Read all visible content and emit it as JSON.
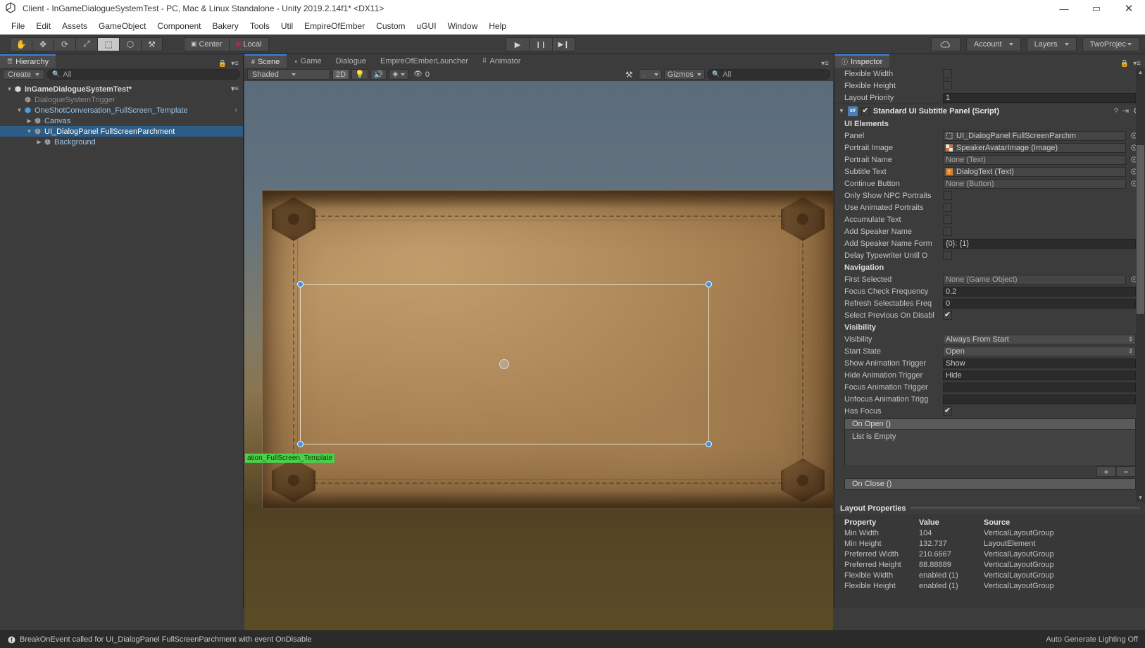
{
  "window": {
    "title": "Client - InGameDialogueSystemTest - PC, Mac & Linux Standalone - Unity 2019.2.14f1* <DX11>",
    "app_icon": "unity-icon",
    "minimize": "—",
    "maximize": "▭",
    "close": "✕"
  },
  "menubar": {
    "items": [
      {
        "label": "File"
      },
      {
        "label": "Edit"
      },
      {
        "label": "Assets"
      },
      {
        "label": "GameObject"
      },
      {
        "label": "Component"
      },
      {
        "label": "Bakery"
      },
      {
        "label": "Tools"
      },
      {
        "label": "Util"
      },
      {
        "label": "EmpireOfEmber"
      },
      {
        "label": "Custom"
      },
      {
        "label": "uGUI"
      },
      {
        "label": "Window"
      },
      {
        "label": "Help"
      }
    ]
  },
  "toolbar": {
    "transform_tools": [
      {
        "name": "hand-tool",
        "glyph": "✋",
        "active": false
      },
      {
        "name": "move-tool",
        "glyph": "✥",
        "active": false
      },
      {
        "name": "rotate-tool",
        "glyph": "⟳",
        "active": false
      },
      {
        "name": "scale-tool",
        "glyph": "⤢",
        "active": false
      },
      {
        "name": "rect-tool",
        "glyph": "⬚",
        "active": true
      },
      {
        "name": "transform-tool",
        "glyph": "⬡",
        "active": false
      },
      {
        "name": "custom-tool",
        "glyph": "⚒",
        "active": false
      }
    ],
    "pivot_mode": "Center",
    "pivot_rotation": "Local",
    "play": "▶",
    "pause": "❙❙",
    "step": "▶❙",
    "cloud_label": "cloud-icon",
    "account": "Account",
    "layers": "Layers",
    "layout": "TwoProjec"
  },
  "hierarchy": {
    "tab": "Hierarchy",
    "create_label": "Create",
    "search_placeholder": "All",
    "items": [
      {
        "label": "InGameDialogueSystemTest*",
        "indent": 0,
        "arrow": "▼",
        "style": "root",
        "selected": false,
        "icon": "scene-icon"
      },
      {
        "label": "DialogueSystemTrigger",
        "indent": 1,
        "arrow": "",
        "style": "dim",
        "selected": false,
        "icon": "cube-icon"
      },
      {
        "label": "OneShotConversation_FullScreen_Template",
        "indent": 1,
        "arrow": "▼",
        "style": "blue",
        "selected": false,
        "icon": "prefab-icon"
      },
      {
        "label": "Canvas",
        "indent": 2,
        "arrow": "▶",
        "style": "blue",
        "selected": false,
        "icon": "cube-icon"
      },
      {
        "label": "UI_DialogPanel FullScreenParchment",
        "indent": 2,
        "arrow": "▼",
        "style": "sel",
        "selected": true,
        "icon": "cube-icon"
      },
      {
        "label": "Background",
        "indent": 3,
        "arrow": "▶",
        "style": "blue",
        "selected": false,
        "icon": "cube-icon"
      }
    ]
  },
  "scene": {
    "tabs": [
      {
        "label": "Scene",
        "icon": "scene-grid-icon",
        "active": true
      },
      {
        "label": "Game",
        "icon": "game-icon",
        "active": false
      },
      {
        "label": "Dialogue",
        "icon": "",
        "active": false
      },
      {
        "label": "EmpireOfEmberLauncher",
        "icon": "",
        "active": false
      },
      {
        "label": "Animator",
        "icon": "animator-icon",
        "active": false
      }
    ],
    "draw_mode": "Shaded",
    "mode_2d": "2D",
    "lighting_icon": "light-bulb-icon",
    "audio_icon": "speaker-icon",
    "fx_icon": "effects-icon",
    "hidden_count": "0",
    "tools_icon": "tools-icon",
    "camera_icon": "camera-icon",
    "gizmos_label": "Gizmos",
    "gizmo_search_placeholder": "All",
    "gizmo_object_label": "ation_FullScreen_Template"
  },
  "inspector": {
    "tab": "Inspector",
    "top_rows": [
      {
        "label": "Flexible Width",
        "type": "checkbox",
        "checked": false
      },
      {
        "label": "Flexible Height",
        "type": "checkbox",
        "checked": false
      },
      {
        "label": "Layout Priority",
        "type": "text",
        "value": "1"
      }
    ],
    "component": {
      "title": "Standard UI Subtitle Panel (Script)",
      "enabled": true,
      "foldout": "▼",
      "help_icon": "help-icon",
      "preset_icon": "preset-icon",
      "gear_icon": "gear-icon"
    },
    "sections": [
      {
        "heading": "UI Elements",
        "rows": [
          {
            "label": "Panel",
            "type": "object",
            "value": "UI_DialogPanel FullScreenParchm",
            "icon": "rect-transform-icon",
            "picker": true
          },
          {
            "label": "Portrait Image",
            "type": "object",
            "value": "SpeakerAvatarImage (Image)",
            "icon": "image-icon",
            "picker": true
          },
          {
            "label": "Portrait Name",
            "type": "object",
            "value": "None (Text)",
            "icon": "",
            "picker": true
          },
          {
            "label": "Subtitle Text",
            "type": "object",
            "value": "DialogText (Text)",
            "icon": "text-icon",
            "picker": true
          },
          {
            "label": "Continue Button",
            "type": "object",
            "value": "None (Button)",
            "icon": "",
            "picker": true
          },
          {
            "label": "Only Show NPC Portraits",
            "type": "checkbox",
            "checked": false
          },
          {
            "label": "Use Animated Portraits",
            "type": "checkbox",
            "checked": false
          },
          {
            "label": "Accumulate Text",
            "type": "checkbox",
            "checked": false
          },
          {
            "label": "Add Speaker Name",
            "type": "checkbox",
            "checked": false
          },
          {
            "label": "Add Speaker Name Form",
            "type": "text",
            "value": "{0}: {1}"
          },
          {
            "label": "Delay Typewriter Until O",
            "type": "checkbox",
            "checked": false
          }
        ]
      },
      {
        "heading": "Navigation",
        "rows": [
          {
            "label": "First Selected",
            "type": "object",
            "value": "None (Game Object)",
            "icon": "",
            "picker": true
          },
          {
            "label": "Focus Check Frequency",
            "type": "text",
            "value": "0.2"
          },
          {
            "label": "Refresh Selectables Freq",
            "type": "text",
            "value": "0"
          },
          {
            "label": "Select Previous On Disabl",
            "type": "checkbox",
            "checked": true
          }
        ]
      },
      {
        "heading": "Visibility",
        "rows": [
          {
            "label": "Visibility",
            "type": "dropdown",
            "value": "Always From Start"
          },
          {
            "label": "Start State",
            "type": "dropdown",
            "value": "Open"
          },
          {
            "label": "Show Animation Trigger",
            "type": "text",
            "value": "Show"
          },
          {
            "label": "Hide Animation Trigger",
            "type": "text",
            "value": "Hide"
          },
          {
            "label": "Focus Animation Trigger",
            "type": "text",
            "value": ""
          },
          {
            "label": "Unfocus Animation Trigg",
            "type": "text",
            "value": ""
          },
          {
            "label": "Has Focus",
            "type": "checkbox",
            "checked": true
          }
        ]
      }
    ],
    "events": [
      {
        "header": "On Open ()",
        "body": "List is Empty",
        "add": "+",
        "remove": "−"
      },
      {
        "header": "On Close ()",
        "body": "",
        "add": "+",
        "remove": "−"
      }
    ]
  },
  "layout_properties": {
    "title": "Layout Properties",
    "columns": [
      "Property",
      "Value",
      "Source"
    ],
    "rows": [
      {
        "property": "Min Width",
        "value": "104",
        "source": "VerticalLayoutGroup"
      },
      {
        "property": "Min Height",
        "value": "132.737",
        "source": "LayoutElement"
      },
      {
        "property": "Preferred Width",
        "value": "210.6667",
        "source": "VerticalLayoutGroup"
      },
      {
        "property": "Preferred Height",
        "value": "88.88889",
        "source": "VerticalLayoutGroup"
      },
      {
        "property": "Flexible Width",
        "value": "enabled (1)",
        "source": "VerticalLayoutGroup"
      },
      {
        "property": "Flexible Height",
        "value": "enabled (1)",
        "source": "VerticalLayoutGroup"
      }
    ]
  },
  "statusbar": {
    "icon": "error-icon",
    "message": "BreakOnEvent called for UI_DialogPanel FullScreenParchment with event OnDisable",
    "right": "Auto Generate Lighting Off"
  },
  "colors": {
    "selection_blue": "#2c5d87",
    "handle_blue": "#3f92e0",
    "gizmo_green": "#49d14b",
    "panel_bg": "#3c3c3c",
    "parchment": "#a07a4c"
  }
}
